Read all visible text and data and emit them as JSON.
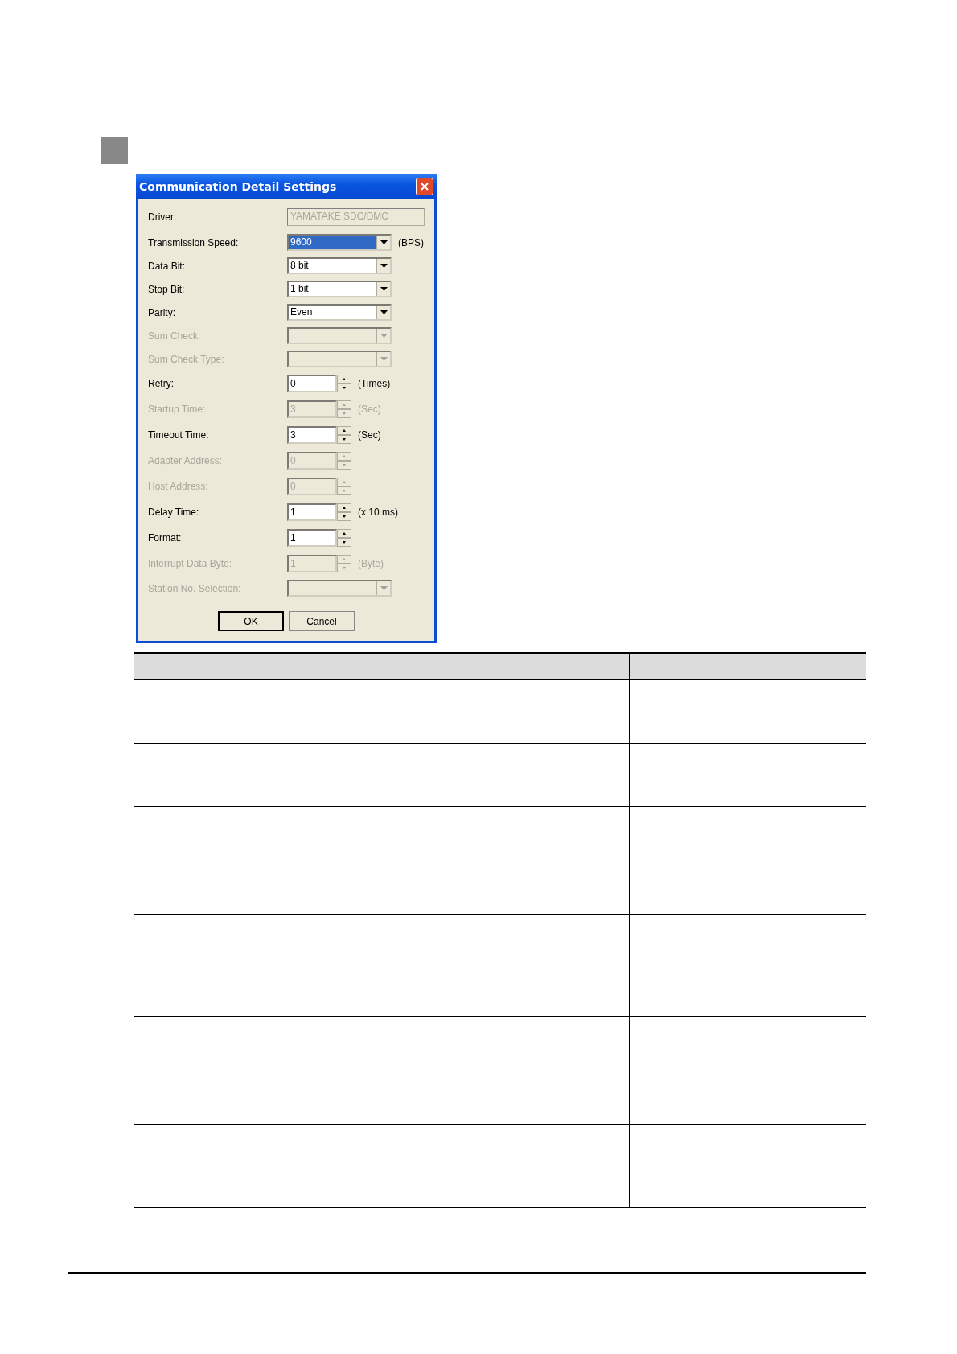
{
  "dialog": {
    "title": "Communication Detail Settings",
    "fields": [
      {
        "kind": "text",
        "label": "Driver:",
        "value": "YAMATAKE SDC/DMC",
        "disabled": true,
        "highlighted": false
      },
      {
        "kind": "combo",
        "label": "Transmission Speed:",
        "value": "9600",
        "unit": "(BPS)",
        "disabled": false,
        "highlighted": true
      },
      {
        "kind": "combo",
        "label": "Data Bit:",
        "value": "8 bit",
        "disabled": false,
        "highlighted": false
      },
      {
        "kind": "combo",
        "label": "Stop Bit:",
        "value": "1 bit",
        "disabled": false,
        "highlighted": false
      },
      {
        "kind": "combo",
        "label": "Parity:",
        "value": "Even",
        "disabled": false,
        "highlighted": false
      },
      {
        "kind": "combo",
        "label": "Sum Check:",
        "disabled": true,
        "highlighted": false
      },
      {
        "kind": "combo",
        "label": "Sum Check Type:",
        "disabled": true,
        "highlighted": false
      },
      {
        "kind": "spin",
        "label": "Retry:",
        "value": "0",
        "unit": "(Times)",
        "disabled": false,
        "highlighted": false
      },
      {
        "kind": "spin",
        "label": "Startup Time:",
        "value": "3",
        "unit": "(Sec)",
        "disabled": true,
        "highlighted": false
      },
      {
        "kind": "spin",
        "label": "Timeout Time:",
        "value": "3",
        "unit": "(Sec)",
        "disabled": false,
        "highlighted": false
      },
      {
        "kind": "spin",
        "label": "Adapter Address:",
        "value": "0",
        "disabled": true,
        "highlighted": false
      },
      {
        "kind": "spin",
        "label": "Host Address:",
        "value": "0",
        "disabled": true,
        "highlighted": false
      },
      {
        "kind": "spin",
        "label": "Delay Time:",
        "value": "1",
        "unit": "(x 10 ms)",
        "disabled": false,
        "highlighted": false
      },
      {
        "kind": "spin",
        "label": "Format:",
        "value": "1",
        "disabled": false,
        "highlighted": false
      },
      {
        "kind": "spin",
        "label": "Interrupt Data Byte:",
        "value": "1",
        "unit": "(Byte)",
        "disabled": true,
        "highlighted": false
      },
      {
        "kind": "combo",
        "label": "Station No. Selection:",
        "disabled": true,
        "highlighted": false
      }
    ],
    "buttons": [
      {
        "label": "OK",
        "default": true
      },
      {
        "label": "Cancel",
        "default": false
      }
    ]
  }
}
